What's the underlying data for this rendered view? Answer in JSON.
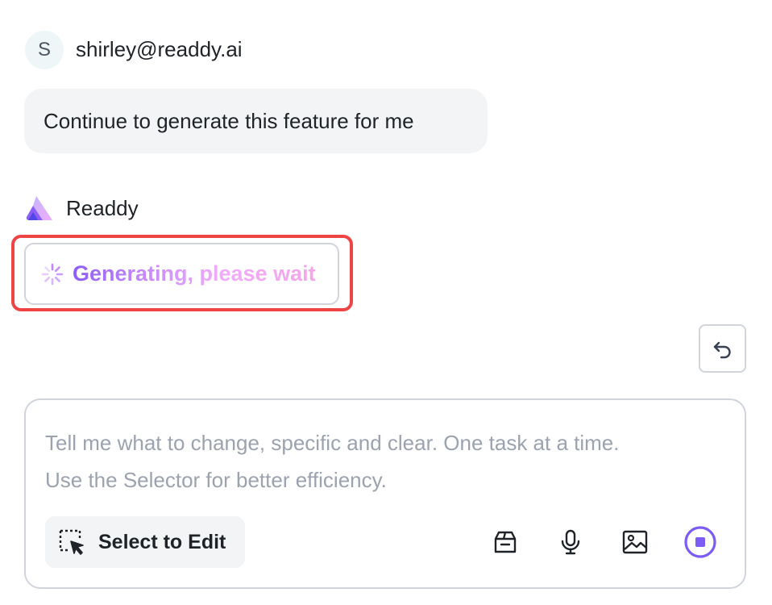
{
  "user": {
    "avatar_initial": "S",
    "email": "shirley@readdy.ai",
    "message": "Continue to generate this feature for me"
  },
  "assistant": {
    "name": "Readdy",
    "status": "Generating, please wait"
  },
  "composer": {
    "placeholder_line1": "Tell me what to change, specific and clear. One task at a time.",
    "placeholder_line2": "Use the Selector for better efficiency.",
    "select_button_label": "Select to Edit"
  },
  "icons": {
    "undo": "undo-icon",
    "select": "select-cursor-icon",
    "box": "package-icon",
    "mic": "microphone-icon",
    "image": "image-icon",
    "stop": "stop-icon"
  },
  "colors": {
    "highlight": "#ef4444",
    "accent": "#7c5cf5",
    "gradient_start": "#8b5cf6",
    "gradient_end": "#f5a5e8"
  }
}
